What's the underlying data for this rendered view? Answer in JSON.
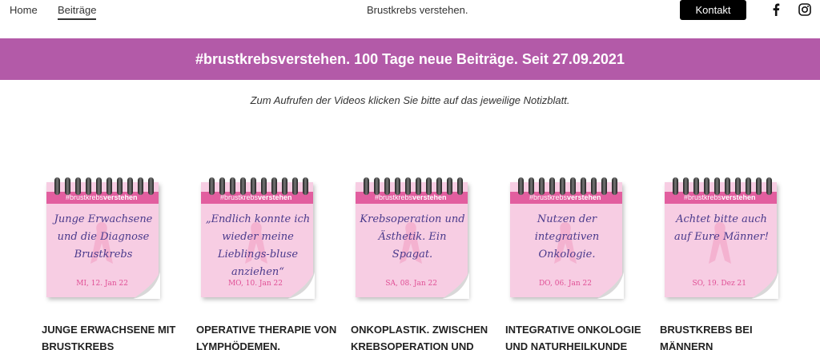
{
  "nav": {
    "home": "Home",
    "beitraege": "Beiträge",
    "site_title": "Brustkrebs verstehen.",
    "kontakt": "Kontakt"
  },
  "social": {
    "facebook": "facebook-icon",
    "instagram": "instagram-icon"
  },
  "banner": {
    "text": "#brustkrebsverstehen. 100 Tage neue Beiträge. Seit 27.09.2021",
    "color": "#b35aa8"
  },
  "intro": "Zum Aufrufen der Videos klicken Sie bitte auf das jeweilige Notizblatt.",
  "brand": {
    "prefix": "#brustkrebs",
    "suffix": "verstehen"
  },
  "cards": [
    {
      "note": "Junge Erwachsene und die Diagnose Brustkrebs",
      "date": "MI, 12. Jan 22",
      "title": "JUNGE ERWACHSENE MIT BRUSTKREBS"
    },
    {
      "note": "„Endlich konnte ich wieder meine Lieblings-bluse anziehen“",
      "date": "MO, 10. Jan 22",
      "title": "OPERATIVE THERAPIE VON LYMPHÖDEMEN."
    },
    {
      "note": "Krebsoperation und Ästhetik. Ein Spagat.",
      "date": "SA, 08. Jan 22",
      "title": "ONKOPLASTIK. ZWISCHEN KREBSOPERATION UND"
    },
    {
      "note": "Nutzen der integrativen Onkologie.",
      "date": "DO, 06. Jan 22",
      "title": "INTEGRATIVE ONKOLOGIE UND NATURHEILKUNDE"
    },
    {
      "note": "Achtet bitte auch auf Eure Männer!",
      "date": "SO, 19. Dez 21",
      "title": "BRUSTKREBS BEI MÄNNERN"
    }
  ]
}
